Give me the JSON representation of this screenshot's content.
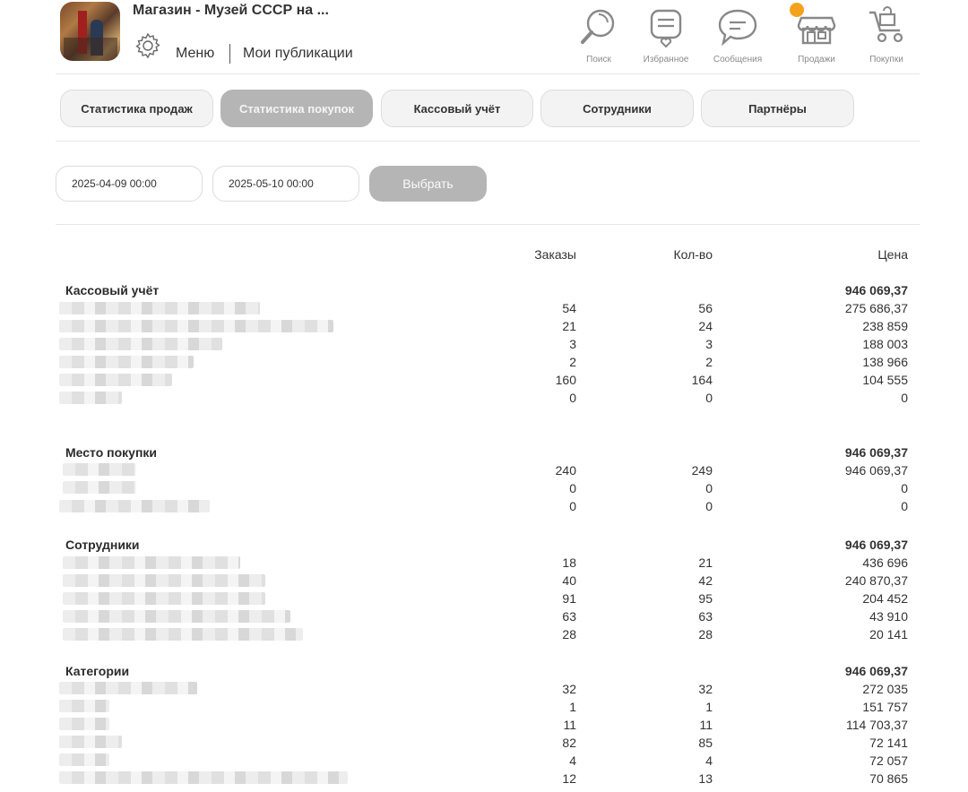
{
  "header": {
    "shop_title": "Магазин - Музей СССР на ...",
    "menu_label": "Меню",
    "publications_label": "Мои публикации",
    "nav": [
      {
        "label": "Поиск",
        "icon": "search-icon"
      },
      {
        "label": "Избранное",
        "icon": "favorites-icon"
      },
      {
        "label": "Сообщения",
        "icon": "messages-icon"
      },
      {
        "label": "Продажи",
        "icon": "store-icon"
      },
      {
        "label": "Покупки",
        "icon": "cart-icon"
      }
    ],
    "accent_color": "#f4a21c"
  },
  "tabs": [
    {
      "label": "Статистика продаж",
      "active": false
    },
    {
      "label": "Статистика покупок",
      "active": true
    },
    {
      "label": "Кассовый учёт",
      "active": false
    },
    {
      "label": "Сотрудники",
      "active": false
    },
    {
      "label": "Партнёры",
      "active": false
    }
  ],
  "filter": {
    "date_from": "2025-04-09 00:00",
    "date_to": "2025-05-10 00:00",
    "apply_label": "Выбрать"
  },
  "table": {
    "columns": {
      "orders": "Заказы",
      "qty": "Кол-во",
      "price": "Цена"
    },
    "sections": [
      {
        "title": "Кассовый учёт",
        "total": "946 069,37",
        "rows": [
          {
            "orders": "54",
            "qty": "56",
            "price": "275 686,37"
          },
          {
            "orders": "21",
            "qty": "24",
            "price": "238 859"
          },
          {
            "orders": "3",
            "qty": "3",
            "price": "188 003"
          },
          {
            "orders": "2",
            "qty": "2",
            "price": "138 966"
          },
          {
            "orders": "160",
            "qty": "164",
            "price": "104 555"
          },
          {
            "orders": "0",
            "qty": "0",
            "price": "0"
          }
        ]
      },
      {
        "title": "Место покупки",
        "total": "946 069,37",
        "rows": [
          {
            "orders": "240",
            "qty": "249",
            "price": "946 069,37"
          },
          {
            "orders": "0",
            "qty": "0",
            "price": "0"
          },
          {
            "orders": "0",
            "qty": "0",
            "price": "0"
          }
        ]
      },
      {
        "title": "Сотрудники",
        "total": "946 069,37",
        "rows": [
          {
            "orders": "18",
            "qty": "21",
            "price": "436 696"
          },
          {
            "orders": "40",
            "qty": "42",
            "price": "240 870,37"
          },
          {
            "orders": "91",
            "qty": "95",
            "price": "204 452"
          },
          {
            "orders": "63",
            "qty": "63",
            "price": "43 910"
          },
          {
            "orders": "28",
            "qty": "28",
            "price": "20 141"
          }
        ]
      },
      {
        "title": "Категории",
        "total": "946 069,37",
        "rows": [
          {
            "orders": "32",
            "qty": "32",
            "price": "272 035"
          },
          {
            "orders": "1",
            "qty": "1",
            "price": "151 757"
          },
          {
            "orders": "11",
            "qty": "11",
            "price": "114 703,37"
          },
          {
            "orders": "82",
            "qty": "85",
            "price": "72 141"
          },
          {
            "orders": "4",
            "qty": "4",
            "price": "72 057"
          },
          {
            "orders": "12",
            "qty": "13",
            "price": "70 865"
          }
        ]
      }
    ]
  }
}
